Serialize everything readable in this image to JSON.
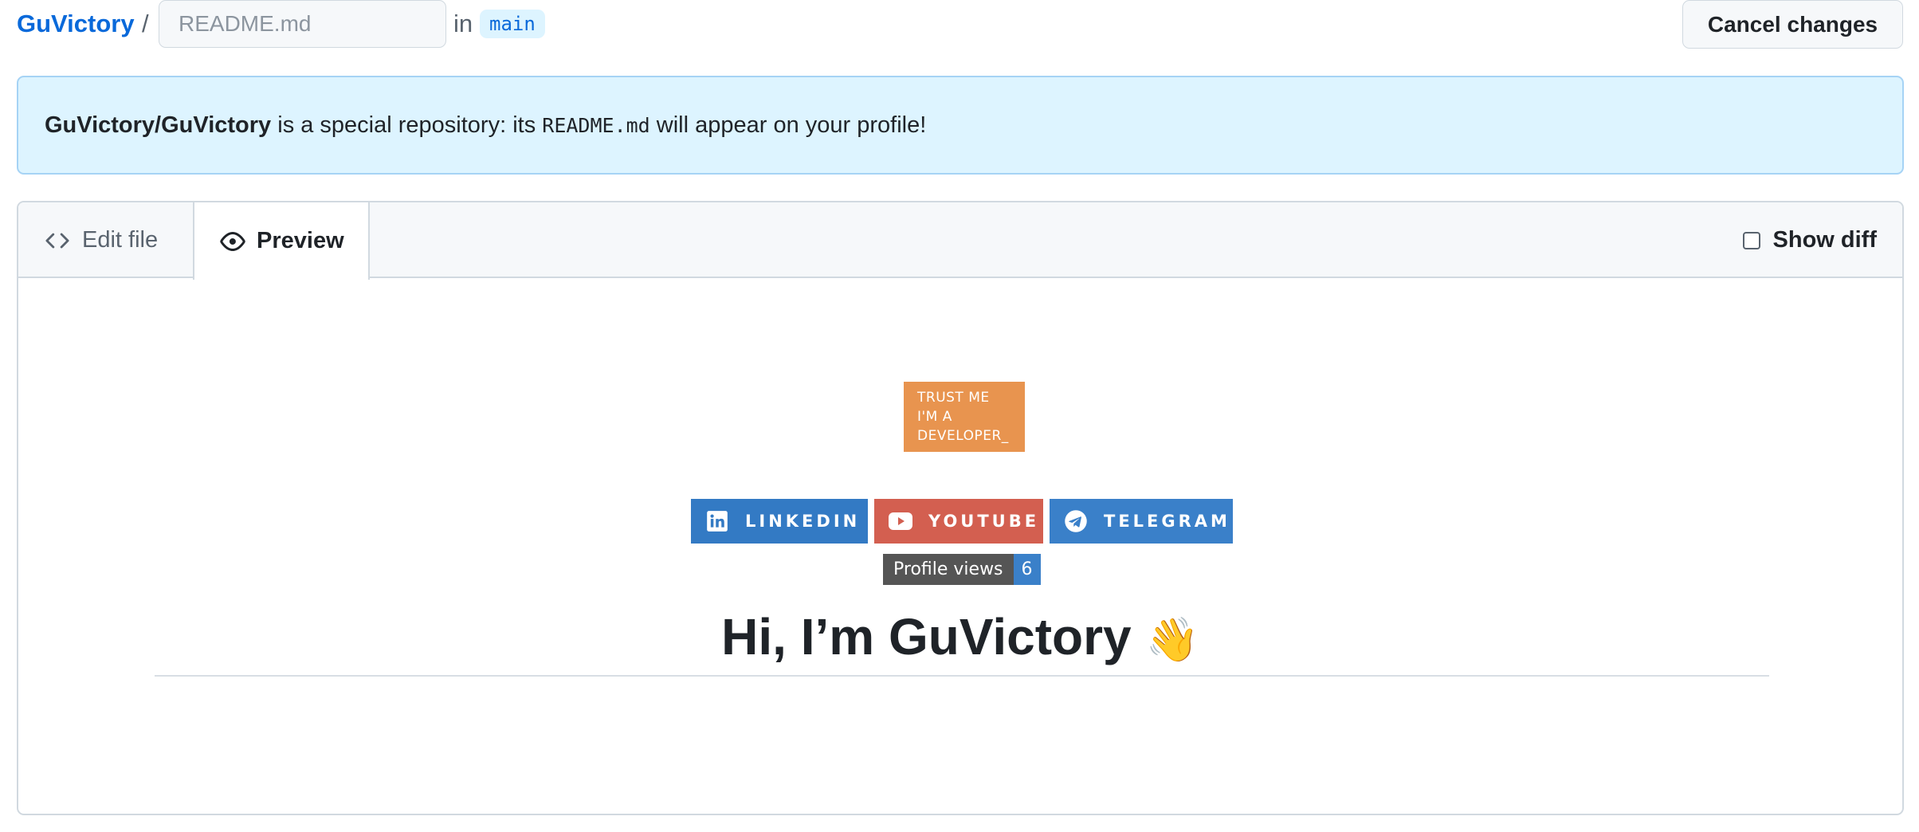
{
  "header": {
    "repo_owner": "GuVictory",
    "separator": "/",
    "filename_placeholder": "README.md",
    "in_label": "in",
    "branch": "main",
    "cancel_label": "Cancel changes"
  },
  "flash": {
    "repo_full": "GuVictory/GuVictory",
    "text_before": " is a special repository: its ",
    "code": "README.md",
    "text_after": " will appear on your profile!"
  },
  "editor": {
    "tabs": [
      {
        "label": "Edit file",
        "icon": "code-icon",
        "active": false
      },
      {
        "label": "Preview",
        "icon": "eye-icon",
        "active": true
      }
    ],
    "show_diff_label": "Show diff",
    "show_diff_checked": false
  },
  "preview": {
    "trust_badge": {
      "line1": "TRUST ME",
      "line2": "I'M A",
      "line3": "DEVELOPER_"
    },
    "social": [
      {
        "label": "LINKEDIN",
        "icon": "linkedin-icon",
        "color": "#337ac4"
      },
      {
        "label": "YOUTUBE",
        "icon": "youtube-icon",
        "color": "#d35f50"
      },
      {
        "label": "TELEGRAM",
        "icon": "telegram-icon",
        "color": "#3a80c9"
      }
    ],
    "views": {
      "label": "Profile views",
      "count": "6"
    },
    "heading": "Hi, I’m GuVictory",
    "heading_emoji": "👋"
  },
  "colors": {
    "accent": "#0969da",
    "flash_bg": "#ddf4ff",
    "badge_orange": "#e8944f"
  }
}
